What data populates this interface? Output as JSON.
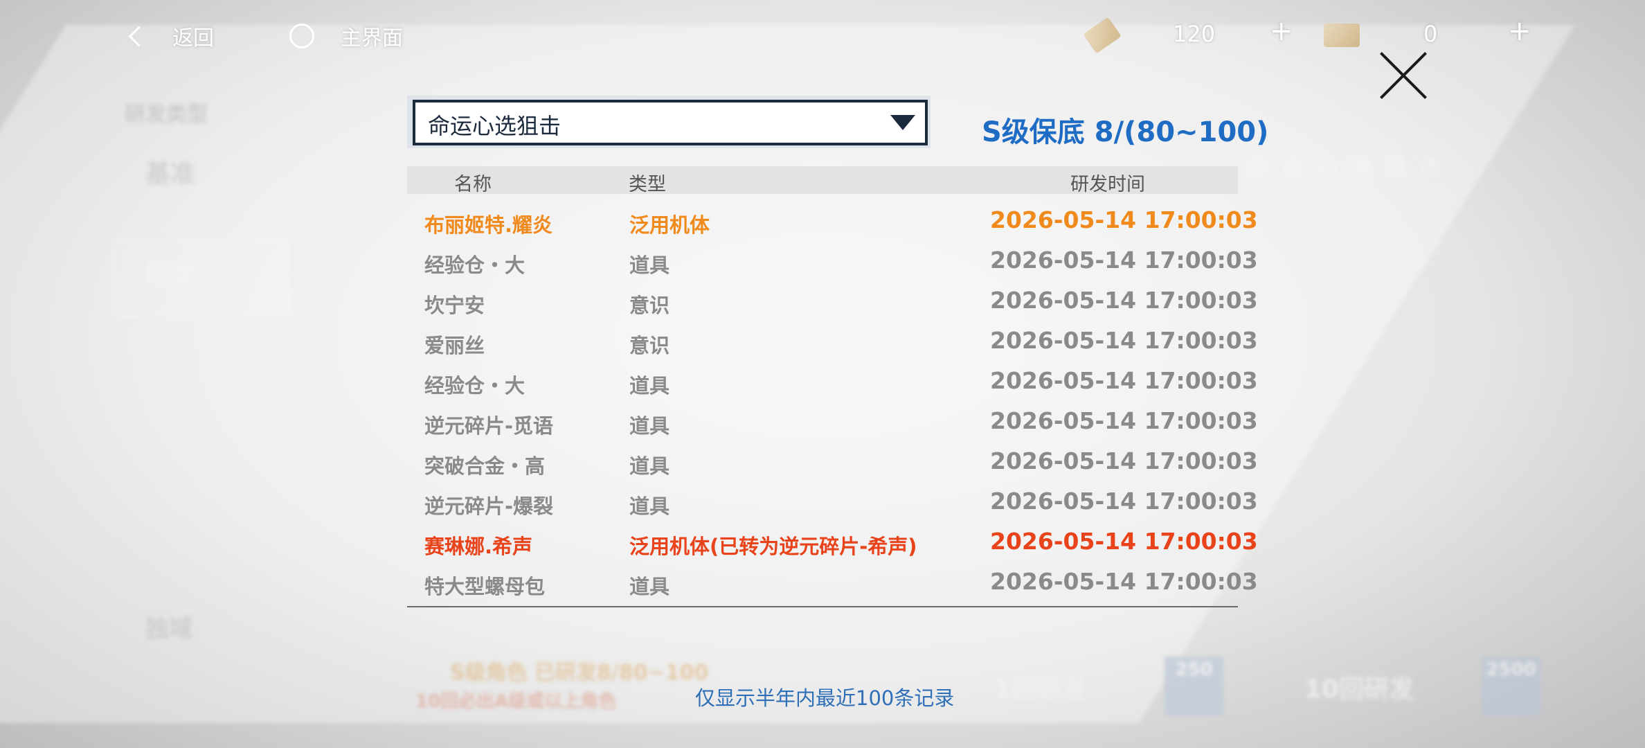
{
  "topbar": {
    "back_label": "返回",
    "home_label": "主界面",
    "currency1_amount": "120",
    "currency2_amount": "0",
    "plus_symbol": "+"
  },
  "background": {
    "dev_type_label": "研发类型",
    "item1": "基准",
    "item2": "限定",
    "item3": "独域",
    "banner_title": "命运心选狙击",
    "pity_text": "S级角色 已研发8/80~100",
    "guarantee_text": "10回必出A级或以上角色",
    "btn_single": "1回研发",
    "btn_single_cost": "250",
    "btn_ten": "10回研发",
    "btn_ten_cost": "2500"
  },
  "dialog": {
    "selected_banner": "命运心选狙击",
    "pity_label": "S级保底 8/(80~100)",
    "columns": {
      "name": "名称",
      "type": "类型",
      "time": "研发时间"
    },
    "records": [
      {
        "name": "布丽姬特.耀炎",
        "type": "泛用机体",
        "time": "2026-05-14 17:00:03",
        "color": "#f08a1c"
      },
      {
        "name": "经验仓・大",
        "type": "道具",
        "time": "2026-05-14 17:00:03",
        "color": "#8a8a8a"
      },
      {
        "name": "坎宁安",
        "type": "意识",
        "time": "2026-05-14 17:00:03",
        "color": "#8a8a8a"
      },
      {
        "name": "爱丽丝",
        "type": "意识",
        "time": "2026-05-14 17:00:03",
        "color": "#8a8a8a"
      },
      {
        "name": "经验仓・大",
        "type": "道具",
        "time": "2026-05-14 17:00:03",
        "color": "#8a8a8a"
      },
      {
        "name": "逆元碎片-觅语",
        "type": "道具",
        "time": "2026-05-14 17:00:03",
        "color": "#8a8a8a"
      },
      {
        "name": "突破合金・高",
        "type": "道具",
        "time": "2026-05-14 17:00:03",
        "color": "#8a8a8a"
      },
      {
        "name": "逆元碎片-爆裂",
        "type": "道具",
        "time": "2026-05-14 17:00:03",
        "color": "#8a8a8a"
      },
      {
        "name": "赛琳娜.希声",
        "type": "泛用机体(已转为逆元碎片-希声)",
        "time": "2026-05-14 17:00:03",
        "color": "#e8431a"
      },
      {
        "name": "特大型螺母包",
        "type": "道具",
        "time": "2026-05-14 17:00:03",
        "color": "#8a8a8a"
      }
    ],
    "footer_note": "仅显示半年内最近100条记录"
  }
}
